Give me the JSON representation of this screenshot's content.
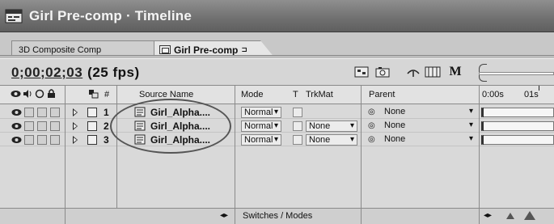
{
  "window": {
    "title": "Girl Pre-comp · Timeline"
  },
  "tabs": [
    {
      "label": "3D Composite Comp",
      "active": false
    },
    {
      "label": "Girl Pre-comp",
      "active": true,
      "close_glyph": "⊐"
    }
  ],
  "timecode": {
    "value": "0;00;02;03",
    "fps": "(25 fps)"
  },
  "toolbar": {
    "icons": [
      "comp-flowchart-icon",
      "snapshot-icon",
      "draft-3d-icon",
      "frame-blending-icon",
      "motion-blur-icon"
    ],
    "motion_blur_label": "M"
  },
  "ruler": {
    "start": "0:00s",
    "tick1": "01s"
  },
  "columns": {
    "av_features_icons": [
      "eye-icon",
      "audio-icon",
      "solo-icon",
      "lock-icon"
    ],
    "label_icon": "label-icon",
    "number": "#",
    "source_name": "Source Name",
    "mode": "Mode",
    "t": "T",
    "trkmat": "TrkMat",
    "parent": "Parent"
  },
  "layers": [
    {
      "number": "1",
      "source_name": "Girl_Alpha....",
      "mode": "Normal",
      "trkmat": "",
      "parent": "None"
    },
    {
      "number": "2",
      "source_name": "Girl_Alpha....",
      "mode": "Normal",
      "trkmat": "None",
      "parent": "None"
    },
    {
      "number": "3",
      "source_name": "Girl_Alpha....",
      "mode": "Normal",
      "trkmat": "None",
      "parent": "None"
    }
  ],
  "footer": {
    "switches_modes_label": "Switches / Modes",
    "toggle_glyph": "◂▸"
  },
  "colors": {
    "titlebar": "#6f6f6f",
    "panel": "#d6d6d6",
    "header": "#e2e2e2"
  }
}
